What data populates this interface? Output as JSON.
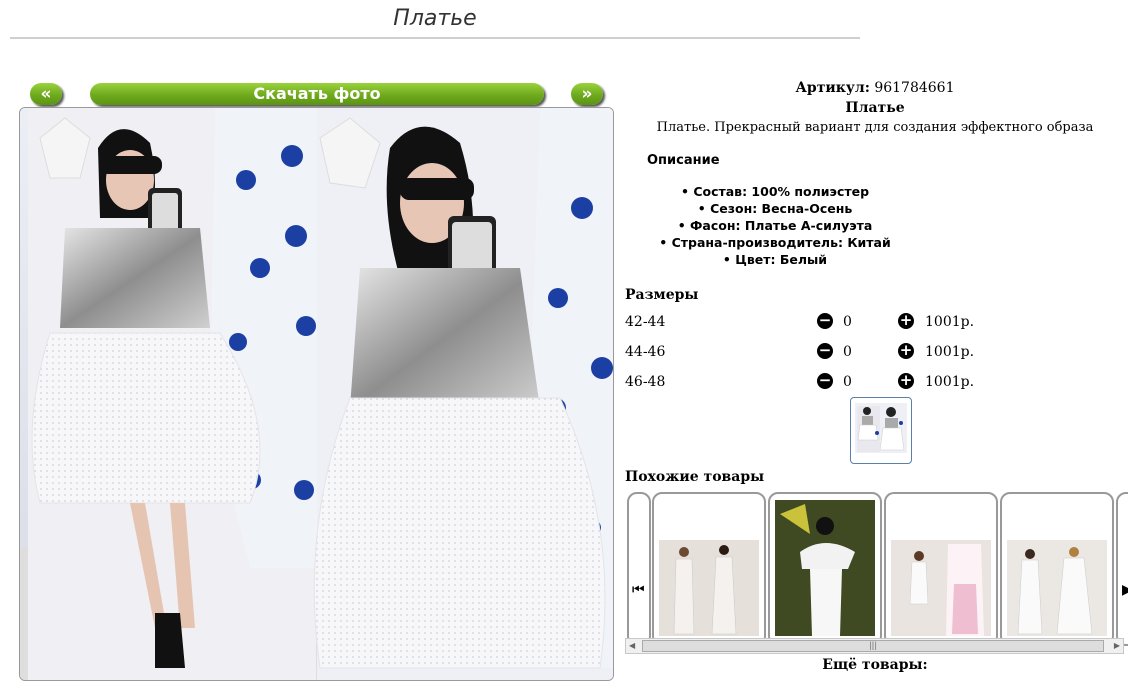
{
  "page": {
    "title": "Платье"
  },
  "gallery": {
    "prev": "«",
    "download": "Скачать фото",
    "next": "»"
  },
  "product": {
    "article_label": "Артикул:",
    "article": "961784661",
    "name": "Платье",
    "short_description": "Платье. Прекрасный вариант для создания эффектного образа",
    "description_heading": "Описание",
    "properties": [
      "Состав: 100% полиэстер",
      "Сезон: Весна-Осень",
      "Фасон: Платье А-силуэта",
      "Страна-производитель: Китай",
      "Цвет: Белый"
    ]
  },
  "sizes": {
    "heading": "Размеры",
    "rows": [
      {
        "size": "42-44",
        "qty": "0",
        "price": "1001р."
      },
      {
        "size": "44-46",
        "qty": "0",
        "price": "1001р."
      },
      {
        "size": "46-48",
        "qty": "0",
        "price": "1001р."
      }
    ],
    "minus_icon": "minus-circle-icon",
    "plus_icon": "plus-circle-icon"
  },
  "similar": {
    "heading": "Похожие товары",
    "more": "Ещё товары:"
  },
  "colors": {
    "button_green": "#6fa91e",
    "thumb_border": "#5a7fa8"
  }
}
